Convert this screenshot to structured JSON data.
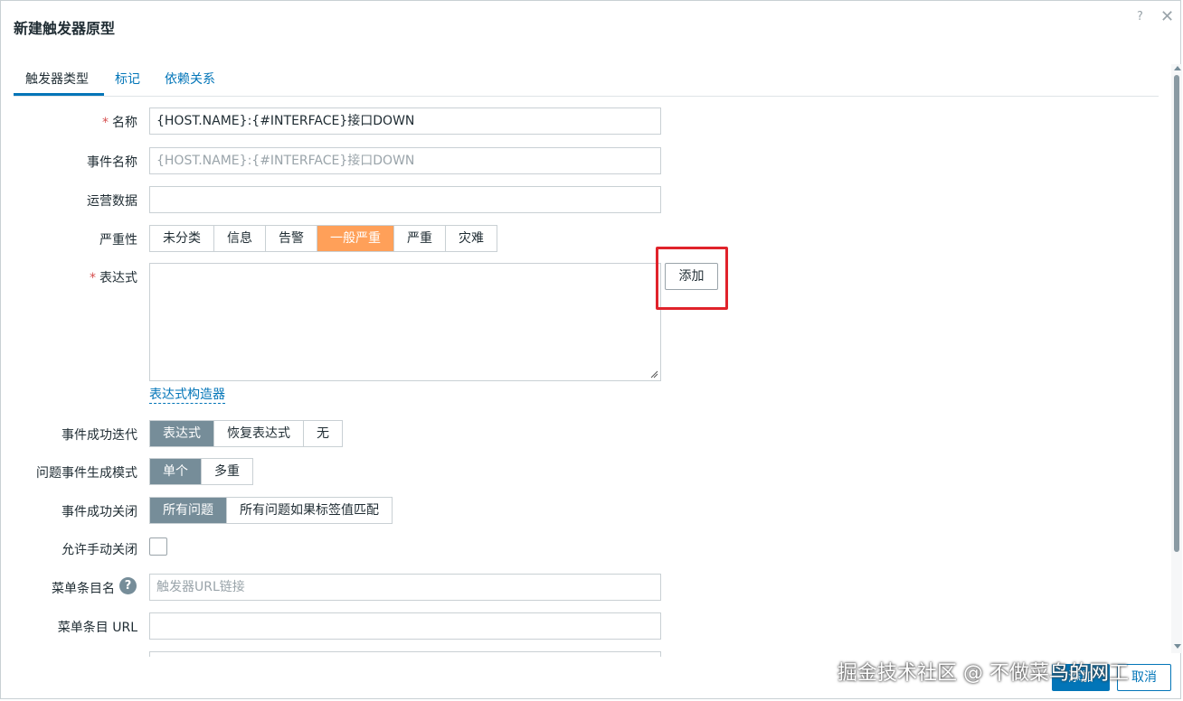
{
  "dialog": {
    "title": "新建触发器原型",
    "help_glyph": "?",
    "close_glyph": "✕"
  },
  "tabs": [
    {
      "label": "触发器类型",
      "active": true
    },
    {
      "label": "标记",
      "active": false
    },
    {
      "label": "依赖关系",
      "active": false
    }
  ],
  "form": {
    "required_mark": "*",
    "name": {
      "label": "名称",
      "value": "{HOST.NAME}:{#INTERFACE}接口DOWN"
    },
    "event_name": {
      "label": "事件名称",
      "placeholder": "{HOST.NAME}:{#INTERFACE}接口DOWN"
    },
    "opdata": {
      "label": "运营数据",
      "value": ""
    },
    "severity": {
      "label": "严重性",
      "options": [
        "未分类",
        "信息",
        "告警",
        "一般严重",
        "严重",
        "灾难"
      ],
      "selected": "一般严重"
    },
    "expression": {
      "label": "表达式",
      "add_button": "添加",
      "constructor_link": "表达式构造器"
    },
    "ok_event_generation": {
      "label": "事件成功迭代",
      "options": [
        "表达式",
        "恢复表达式",
        "无"
      ],
      "selected": "表达式"
    },
    "problem_mode": {
      "label": "问题事件生成模式",
      "options": [
        "单个",
        "多重"
      ],
      "selected": "单个"
    },
    "ok_close": {
      "label": "事件成功关闭",
      "options": [
        "所有问题",
        "所有问题如果标签值匹配"
      ],
      "selected": "所有问题"
    },
    "manual_close": {
      "label": "允许手动关闭",
      "checked": false
    },
    "menu_name": {
      "label": "菜单条目名",
      "help_glyph": "?",
      "placeholder": "触发器URL链接"
    },
    "menu_url": {
      "label": "菜单条目 URL",
      "value": ""
    }
  },
  "footer": {
    "add_label": "添加",
    "cancel_label": "取消"
  },
  "watermark": "掘金技术社区 @ 不做菜鸟的网工",
  "colors": {
    "accent": "#0275b8",
    "selected_segment": "#768d99",
    "severity_average": "#ffa059",
    "highlight": "#e0232b"
  }
}
